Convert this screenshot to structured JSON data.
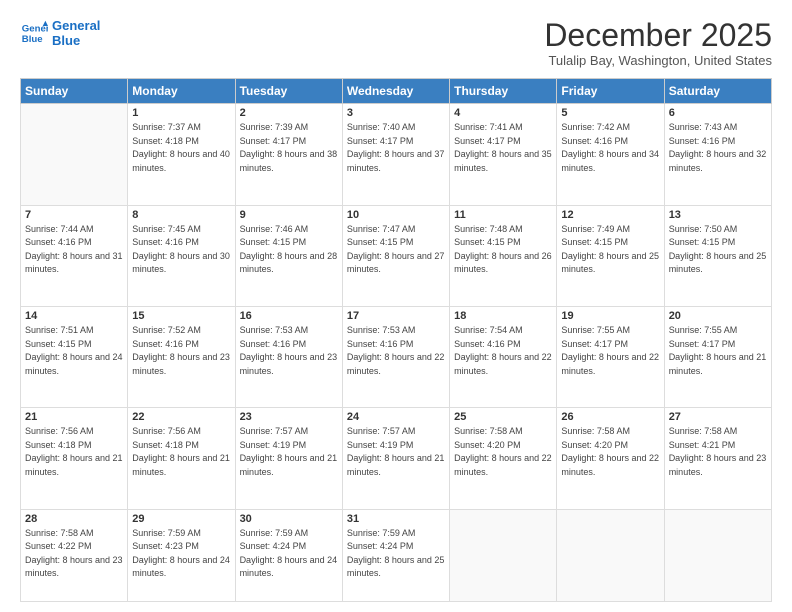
{
  "header": {
    "logo_line1": "General",
    "logo_line2": "Blue",
    "month": "December 2025",
    "location": "Tulalip Bay, Washington, United States"
  },
  "weekdays": [
    "Sunday",
    "Monday",
    "Tuesday",
    "Wednesday",
    "Thursday",
    "Friday",
    "Saturday"
  ],
  "weeks": [
    [
      {
        "day": "",
        "sunrise": "",
        "sunset": "",
        "daylight": ""
      },
      {
        "day": "1",
        "sunrise": "Sunrise: 7:37 AM",
        "sunset": "Sunset: 4:18 PM",
        "daylight": "Daylight: 8 hours and 40 minutes."
      },
      {
        "day": "2",
        "sunrise": "Sunrise: 7:39 AM",
        "sunset": "Sunset: 4:17 PM",
        "daylight": "Daylight: 8 hours and 38 minutes."
      },
      {
        "day": "3",
        "sunrise": "Sunrise: 7:40 AM",
        "sunset": "Sunset: 4:17 PM",
        "daylight": "Daylight: 8 hours and 37 minutes."
      },
      {
        "day": "4",
        "sunrise": "Sunrise: 7:41 AM",
        "sunset": "Sunset: 4:17 PM",
        "daylight": "Daylight: 8 hours and 35 minutes."
      },
      {
        "day": "5",
        "sunrise": "Sunrise: 7:42 AM",
        "sunset": "Sunset: 4:16 PM",
        "daylight": "Daylight: 8 hours and 34 minutes."
      },
      {
        "day": "6",
        "sunrise": "Sunrise: 7:43 AM",
        "sunset": "Sunset: 4:16 PM",
        "daylight": "Daylight: 8 hours and 32 minutes."
      }
    ],
    [
      {
        "day": "7",
        "sunrise": "Sunrise: 7:44 AM",
        "sunset": "Sunset: 4:16 PM",
        "daylight": "Daylight: 8 hours and 31 minutes."
      },
      {
        "day": "8",
        "sunrise": "Sunrise: 7:45 AM",
        "sunset": "Sunset: 4:16 PM",
        "daylight": "Daylight: 8 hours and 30 minutes."
      },
      {
        "day": "9",
        "sunrise": "Sunrise: 7:46 AM",
        "sunset": "Sunset: 4:15 PM",
        "daylight": "Daylight: 8 hours and 28 minutes."
      },
      {
        "day": "10",
        "sunrise": "Sunrise: 7:47 AM",
        "sunset": "Sunset: 4:15 PM",
        "daylight": "Daylight: 8 hours and 27 minutes."
      },
      {
        "day": "11",
        "sunrise": "Sunrise: 7:48 AM",
        "sunset": "Sunset: 4:15 PM",
        "daylight": "Daylight: 8 hours and 26 minutes."
      },
      {
        "day": "12",
        "sunrise": "Sunrise: 7:49 AM",
        "sunset": "Sunset: 4:15 PM",
        "daylight": "Daylight: 8 hours and 25 minutes."
      },
      {
        "day": "13",
        "sunrise": "Sunrise: 7:50 AM",
        "sunset": "Sunset: 4:15 PM",
        "daylight": "Daylight: 8 hours and 25 minutes."
      }
    ],
    [
      {
        "day": "14",
        "sunrise": "Sunrise: 7:51 AM",
        "sunset": "Sunset: 4:15 PM",
        "daylight": "Daylight: 8 hours and 24 minutes."
      },
      {
        "day": "15",
        "sunrise": "Sunrise: 7:52 AM",
        "sunset": "Sunset: 4:16 PM",
        "daylight": "Daylight: 8 hours and 23 minutes."
      },
      {
        "day": "16",
        "sunrise": "Sunrise: 7:53 AM",
        "sunset": "Sunset: 4:16 PM",
        "daylight": "Daylight: 8 hours and 23 minutes."
      },
      {
        "day": "17",
        "sunrise": "Sunrise: 7:53 AM",
        "sunset": "Sunset: 4:16 PM",
        "daylight": "Daylight: 8 hours and 22 minutes."
      },
      {
        "day": "18",
        "sunrise": "Sunrise: 7:54 AM",
        "sunset": "Sunset: 4:16 PM",
        "daylight": "Daylight: 8 hours and 22 minutes."
      },
      {
        "day": "19",
        "sunrise": "Sunrise: 7:55 AM",
        "sunset": "Sunset: 4:17 PM",
        "daylight": "Daylight: 8 hours and 22 minutes."
      },
      {
        "day": "20",
        "sunrise": "Sunrise: 7:55 AM",
        "sunset": "Sunset: 4:17 PM",
        "daylight": "Daylight: 8 hours and 21 minutes."
      }
    ],
    [
      {
        "day": "21",
        "sunrise": "Sunrise: 7:56 AM",
        "sunset": "Sunset: 4:18 PM",
        "daylight": "Daylight: 8 hours and 21 minutes."
      },
      {
        "day": "22",
        "sunrise": "Sunrise: 7:56 AM",
        "sunset": "Sunset: 4:18 PM",
        "daylight": "Daylight: 8 hours and 21 minutes."
      },
      {
        "day": "23",
        "sunrise": "Sunrise: 7:57 AM",
        "sunset": "Sunset: 4:19 PM",
        "daylight": "Daylight: 8 hours and 21 minutes."
      },
      {
        "day": "24",
        "sunrise": "Sunrise: 7:57 AM",
        "sunset": "Sunset: 4:19 PM",
        "daylight": "Daylight: 8 hours and 21 minutes."
      },
      {
        "day": "25",
        "sunrise": "Sunrise: 7:58 AM",
        "sunset": "Sunset: 4:20 PM",
        "daylight": "Daylight: 8 hours and 22 minutes."
      },
      {
        "day": "26",
        "sunrise": "Sunrise: 7:58 AM",
        "sunset": "Sunset: 4:20 PM",
        "daylight": "Daylight: 8 hours and 22 minutes."
      },
      {
        "day": "27",
        "sunrise": "Sunrise: 7:58 AM",
        "sunset": "Sunset: 4:21 PM",
        "daylight": "Daylight: 8 hours and 23 minutes."
      }
    ],
    [
      {
        "day": "28",
        "sunrise": "Sunrise: 7:58 AM",
        "sunset": "Sunset: 4:22 PM",
        "daylight": "Daylight: 8 hours and 23 minutes."
      },
      {
        "day": "29",
        "sunrise": "Sunrise: 7:59 AM",
        "sunset": "Sunset: 4:23 PM",
        "daylight": "Daylight: 8 hours and 24 minutes."
      },
      {
        "day": "30",
        "sunrise": "Sunrise: 7:59 AM",
        "sunset": "Sunset: 4:24 PM",
        "daylight": "Daylight: 8 hours and 24 minutes."
      },
      {
        "day": "31",
        "sunrise": "Sunrise: 7:59 AM",
        "sunset": "Sunset: 4:24 PM",
        "daylight": "Daylight: 8 hours and 25 minutes."
      },
      {
        "day": "",
        "sunrise": "",
        "sunset": "",
        "daylight": ""
      },
      {
        "day": "",
        "sunrise": "",
        "sunset": "",
        "daylight": ""
      },
      {
        "day": "",
        "sunrise": "",
        "sunset": "",
        "daylight": ""
      }
    ]
  ]
}
